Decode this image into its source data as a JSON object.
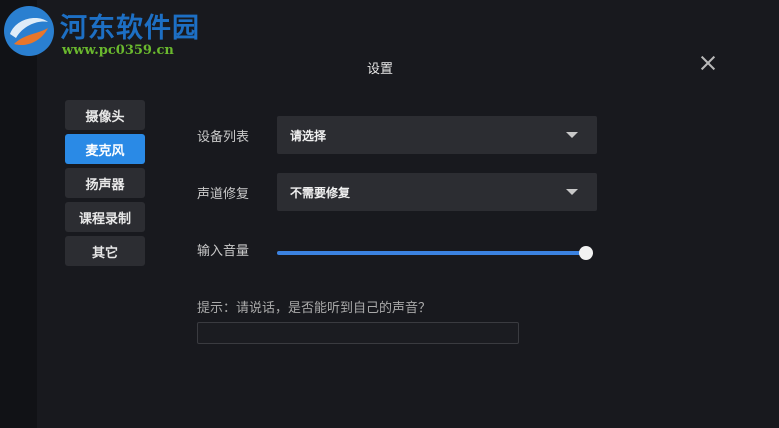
{
  "watermark": {
    "name": "河东软件园",
    "url": "www.pc0359.cn"
  },
  "dialog": {
    "title": "设置"
  },
  "nav": {
    "items": [
      {
        "label": "摄像头"
      },
      {
        "label": "麦克风",
        "active": true
      },
      {
        "label": "扬声器"
      },
      {
        "label": "课程录制"
      },
      {
        "label": "其它"
      }
    ]
  },
  "form": {
    "device_list": {
      "label": "设备列表",
      "value": "请选择"
    },
    "channel_repair": {
      "label": "声道修复",
      "value": "不需要修复"
    },
    "input_volume": {
      "label": "输入音量",
      "level": 1.0
    }
  },
  "hint": "提示：请说话，是否能听到自己的声音？",
  "colors": {
    "accent": "#2a8ae6",
    "panel": "#18191e",
    "control": "#2c2d32"
  }
}
